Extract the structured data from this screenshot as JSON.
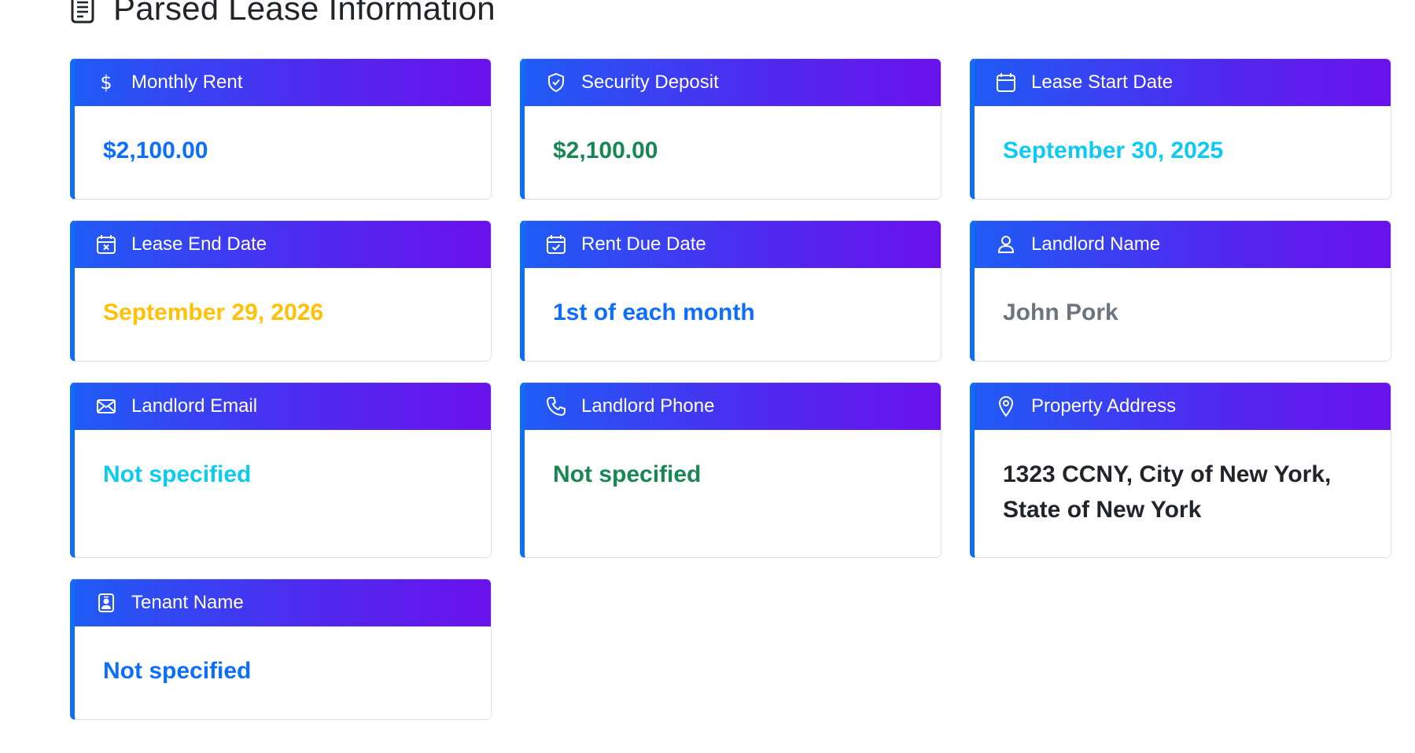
{
  "page": {
    "title": "Parsed Lease Information",
    "title_icon": "document-icon"
  },
  "cards": [
    {
      "label": "Monthly Rent",
      "icon": "dollar-icon",
      "value": "$2,100.00",
      "value_color": "#0d6efd"
    },
    {
      "label": "Security Deposit",
      "icon": "shield-check-icon",
      "value": "$2,100.00",
      "value_color": "#198754"
    },
    {
      "label": "Lease Start Date",
      "icon": "calendar-icon",
      "value": "September 30, 2025",
      "value_color": "#0dcaf0"
    },
    {
      "label": "Lease End Date",
      "icon": "calendar-x-icon",
      "value": "September 29, 2026",
      "value_color": "#ffc107"
    },
    {
      "label": "Rent Due Date",
      "icon": "calendar-check-icon",
      "value": "1st of each month",
      "value_color": "#0d6efd"
    },
    {
      "label": "Landlord Name",
      "icon": "person-icon",
      "value": "John Pork",
      "value_color": "#6c757d"
    },
    {
      "label": "Landlord Email",
      "icon": "envelope-icon",
      "value": "Not specified",
      "value_color": "#0dcaf0"
    },
    {
      "label": "Landlord Phone",
      "icon": "telephone-icon",
      "value": "Not specified",
      "value_color": "#198754"
    },
    {
      "label": "Property Address",
      "icon": "geo-pin-icon",
      "value": "1323 CCNY, City of New York, State of New York",
      "value_color": "#212529"
    },
    {
      "label": "Tenant Name",
      "icon": "person-badge-icon",
      "value": "Not specified",
      "value_color": "#0d6efd"
    }
  ],
  "colors": {
    "header_gradient_start": "#1f5cf5",
    "header_gradient_end": "#6a12ec",
    "card_accent": "#0d6efd"
  }
}
